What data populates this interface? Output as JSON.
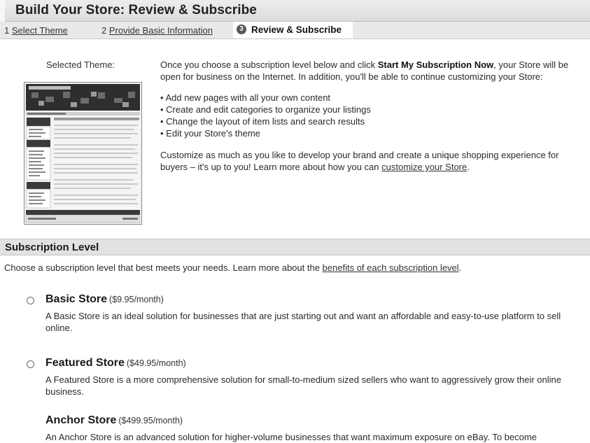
{
  "header": {
    "title": "Build Your Store: Review & Subscribe"
  },
  "steps": [
    {
      "number": "1",
      "label": "Select Theme"
    },
    {
      "number": "2",
      "label": "Provide Basic Information"
    },
    {
      "number": "3",
      "label": "Review & Subscribe"
    }
  ],
  "review": {
    "selected_theme_label": "Selected Theme:",
    "intro_part1": "Once you choose a subscription level below and click ",
    "intro_bold": "Start My Subscription Now",
    "intro_part2": ", your Store will be open for business on the Internet. In addition, you'll be able to continue customizing your Store:",
    "bullets": [
      "• Add new pages with all your own content",
      "• Create and edit categories to organize your listings",
      "• Change the layout of item lists and search results",
      "• Edit your Store's theme"
    ],
    "closing_text": "Customize as much as you like to develop your brand and create a unique shopping experience for buyers – it's up to you! Learn more about how you can ",
    "closing_link": "customize your Store",
    "closing_end": "."
  },
  "subscription": {
    "title": "Subscription Level",
    "intro_text": "Choose a subscription level that best meets your needs. Learn more about the ",
    "intro_link": "benefits of each subscription level",
    "intro_end": ".",
    "options": [
      {
        "name": "Basic Store",
        "price": "($9.95/month)",
        "description": "A Basic Store is an ideal solution for businesses that are just starting out and want an affordable and easy-to-use platform to sell online."
      },
      {
        "name": "Featured Store",
        "price": "($49.95/month)",
        "description": "A Featured Store is a more comprehensive solution for small-to-medium sized sellers who want to aggressively grow their online business."
      },
      {
        "name": "Anchor Store",
        "price": "($499.95/month)",
        "description": "An Anchor Store is an advanced solution for higher-volume businesses that want maximum exposure on eBay. To become"
      }
    ]
  }
}
